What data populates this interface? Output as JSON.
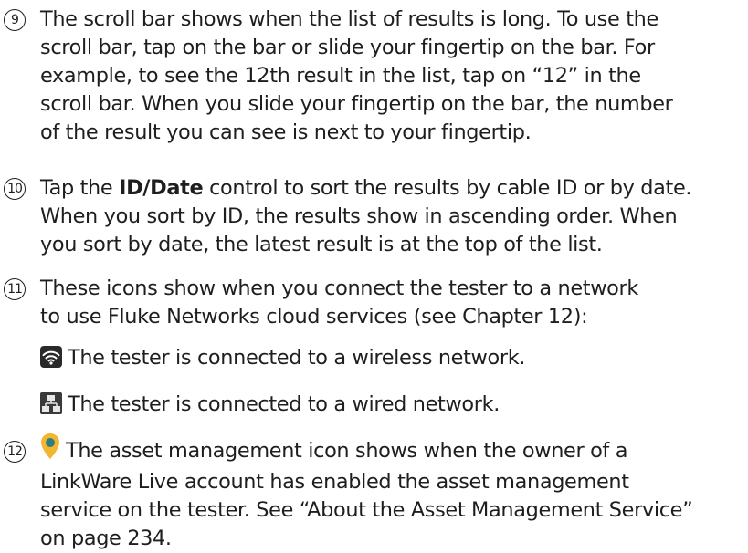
{
  "items": [
    {
      "number": "9",
      "lines": [
        "The scroll bar shows when the list of results is long. To use the",
        "scroll bar, tap on the bar or slide your fingertip on the bar. For",
        "example, to see the 12th result in the list, tap on “12” in the",
        "scroll bar. When you slide your fingertip on the bar, the number",
        "of the result you can see is next to your fingertip."
      ]
    },
    {
      "number": "10",
      "line1_before": "Tap the ",
      "line1_bold": "ID/Date",
      "line1_after": " control to sort the results by cable ID or by date.",
      "lines": [
        "When you sort by ID, the results show in ascending order. When",
        "you sort by date, the latest result is at the top of the list."
      ]
    },
    {
      "number": "11",
      "lines": [
        "These icons show when you connect the tester to a network",
        "to use Fluke Networks cloud services (see Chapter 12):"
      ],
      "wireless_icon": "wifi-icon",
      "wireless_text": "The tester is connected to a wireless network.",
      "wired_icon": "wired-network-icon",
      "wired_text": "The tester is connected to a wired network."
    },
    {
      "number": "12",
      "icon": "asset-management-icon",
      "line1": "The asset management icon shows when the owner of a",
      "lines": [
        "LinkWare Live account has enabled the asset management",
        "service on the tester. See “About the Asset Management Service”",
        "on page 234."
      ]
    }
  ],
  "colors": {
    "text": "#1e1e1e",
    "wifi_icon_bg": "#2a2a2a",
    "asset_icon": "#f2b632"
  }
}
